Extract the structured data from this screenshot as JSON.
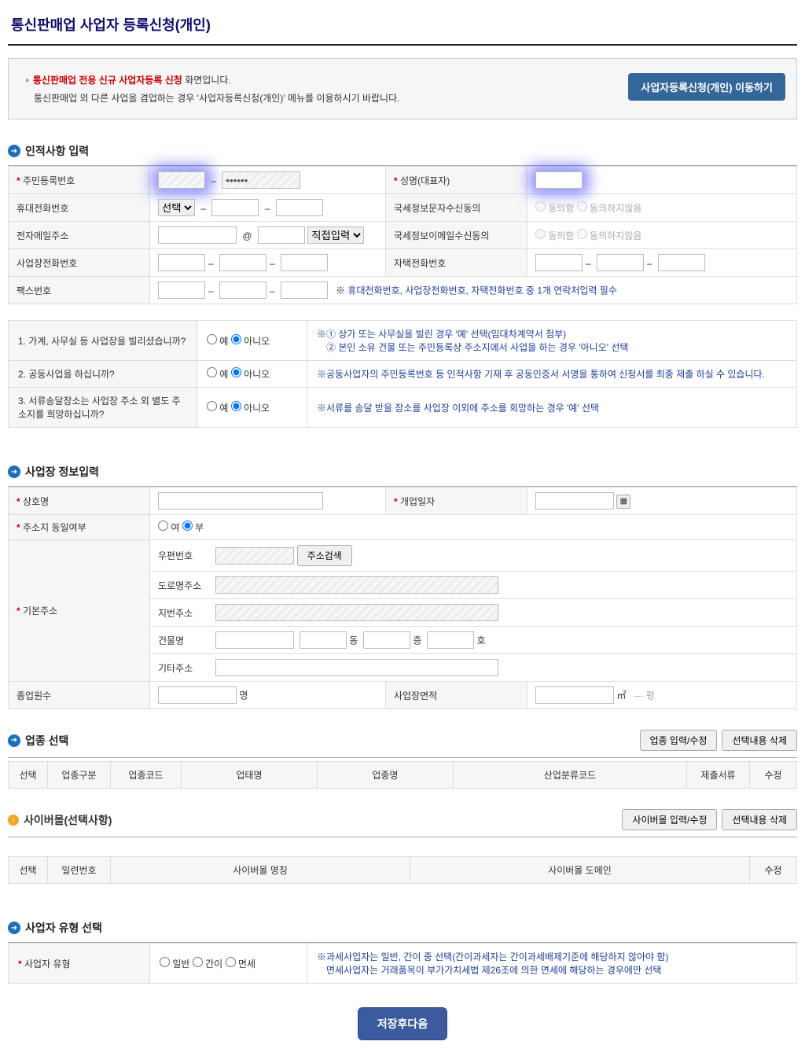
{
  "page": {
    "title": "통신판매업 사업자 등록신청(개인)"
  },
  "notice": {
    "emphasis": "통신판매업 전용 신규 사업자등록 신청",
    "line1_tail": " 화면입니다.",
    "line2": "통신판매업 외 다른 사업을 겸업하는 경우 '사업자등록신청(개인)'  메뉴를 이용하시기 바랍니다.",
    "go_button": "사업자등록신청(개인) 이동하기"
  },
  "section_personal": {
    "title": "인적사항 입력"
  },
  "personal": {
    "rrn_label": "주민등록번호",
    "rrn_mask": "••••••",
    "name_label": "성명(대표자)",
    "mobile_label": "휴대전화번호",
    "mobile_select": "선택",
    "sms_label": "국세정보문자수신동의",
    "agree": "동의함",
    "disagree": "동의하지않음",
    "email_label": "전자메일주소",
    "email_at": "@",
    "email_select": "직접입력",
    "emailrecv_label": "국세정보이메일수신동의",
    "bizphone_label": "사업장전화번호",
    "homephone_label": "자택전화번호",
    "fax_label": "팩스번호",
    "contact_hint": "휴대전화번호, 사업장전화번호, 자택전화번호 중 1개 연락처입력 필수"
  },
  "questions": {
    "q1": "1. 가계, 사무실 등 사업장을 빌리셨습니까?",
    "q1_desc": "※① 상가 또는 사무실을 빌린 경우 '예' 선택(임대차계약서 첨부)\n　② 본인 소유 건물 또는 주민등록상 주소지에서 사업을 하는 경우 '아니오' 선택",
    "q2": "2. 공동사업을 하십니까?",
    "q2_desc": "※공동사업자의 주민등록번호 등 인적사항 기재 후 공동인증서 서명을 통하여 신청서를 최종 제출 하실 수 있습니다.",
    "q3": "3. 서류송달장소는 사업장 주소 외 별도 주소지를 희망하십니까?",
    "q3_desc": "※서류를 송달 받을 장소를 사업장 이외에 주소를 희망하는 경우 '예' 선택",
    "yes": "예",
    "no": "아니오"
  },
  "section_biz": {
    "title": "사업장 정보입력"
  },
  "biz": {
    "bizname_label": "상호명",
    "opendate_label": "개업일자",
    "sameaddr_label": "주소지 동일여부",
    "sameaddr_yes": "여",
    "sameaddr_no": "부",
    "baseaddr_label": "기본주소",
    "zip_label": "우편번호",
    "zip_btn": "주소검색",
    "road_label": "도로명주소",
    "jibun_label": "지번주소",
    "bldg_label": "건물명",
    "dong_unit": "동",
    "floor_unit": "층",
    "ho_unit": "호",
    "etc_label": "기타주소",
    "emp_label": "종업원수",
    "emp_unit": "명",
    "area_label": "사업장면적",
    "area_m2": "㎡",
    "area_pyeong": "--- 평"
  },
  "section_category": {
    "title": "업종 선택",
    "btn_edit": "업종 입력/수정",
    "btn_delete": "선택내용 삭제",
    "cols": [
      "선택",
      "업종구분",
      "업종코드",
      "업태명",
      "업종명",
      "산업분류코드",
      "제출서류",
      "수정"
    ]
  },
  "section_cyber": {
    "title": "사이버몰(선택사항)",
    "btn_edit": "사이버몰 입력/수정",
    "btn_delete": "선택내용 삭제",
    "cols": [
      "선택",
      "일련번호",
      "사이버몰 명칭",
      "사이버몰 도메인",
      "수정"
    ]
  },
  "section_type": {
    "title": "사업자 유형 선택"
  },
  "type": {
    "label": "사업자 유형",
    "opt_general": "일반",
    "opt_simple": "간이",
    "opt_exempt": "면세",
    "desc": "※과세사업자는 일반, 간이 중 선택(간이과세자는 간이과세배제기준에 해당하지 않아야 함)\n　면세사업자는 거래품목이 부가가치세법 제26조에 의한 면세에 해당하는 경우에만 선택"
  },
  "submit": "저장후다음"
}
